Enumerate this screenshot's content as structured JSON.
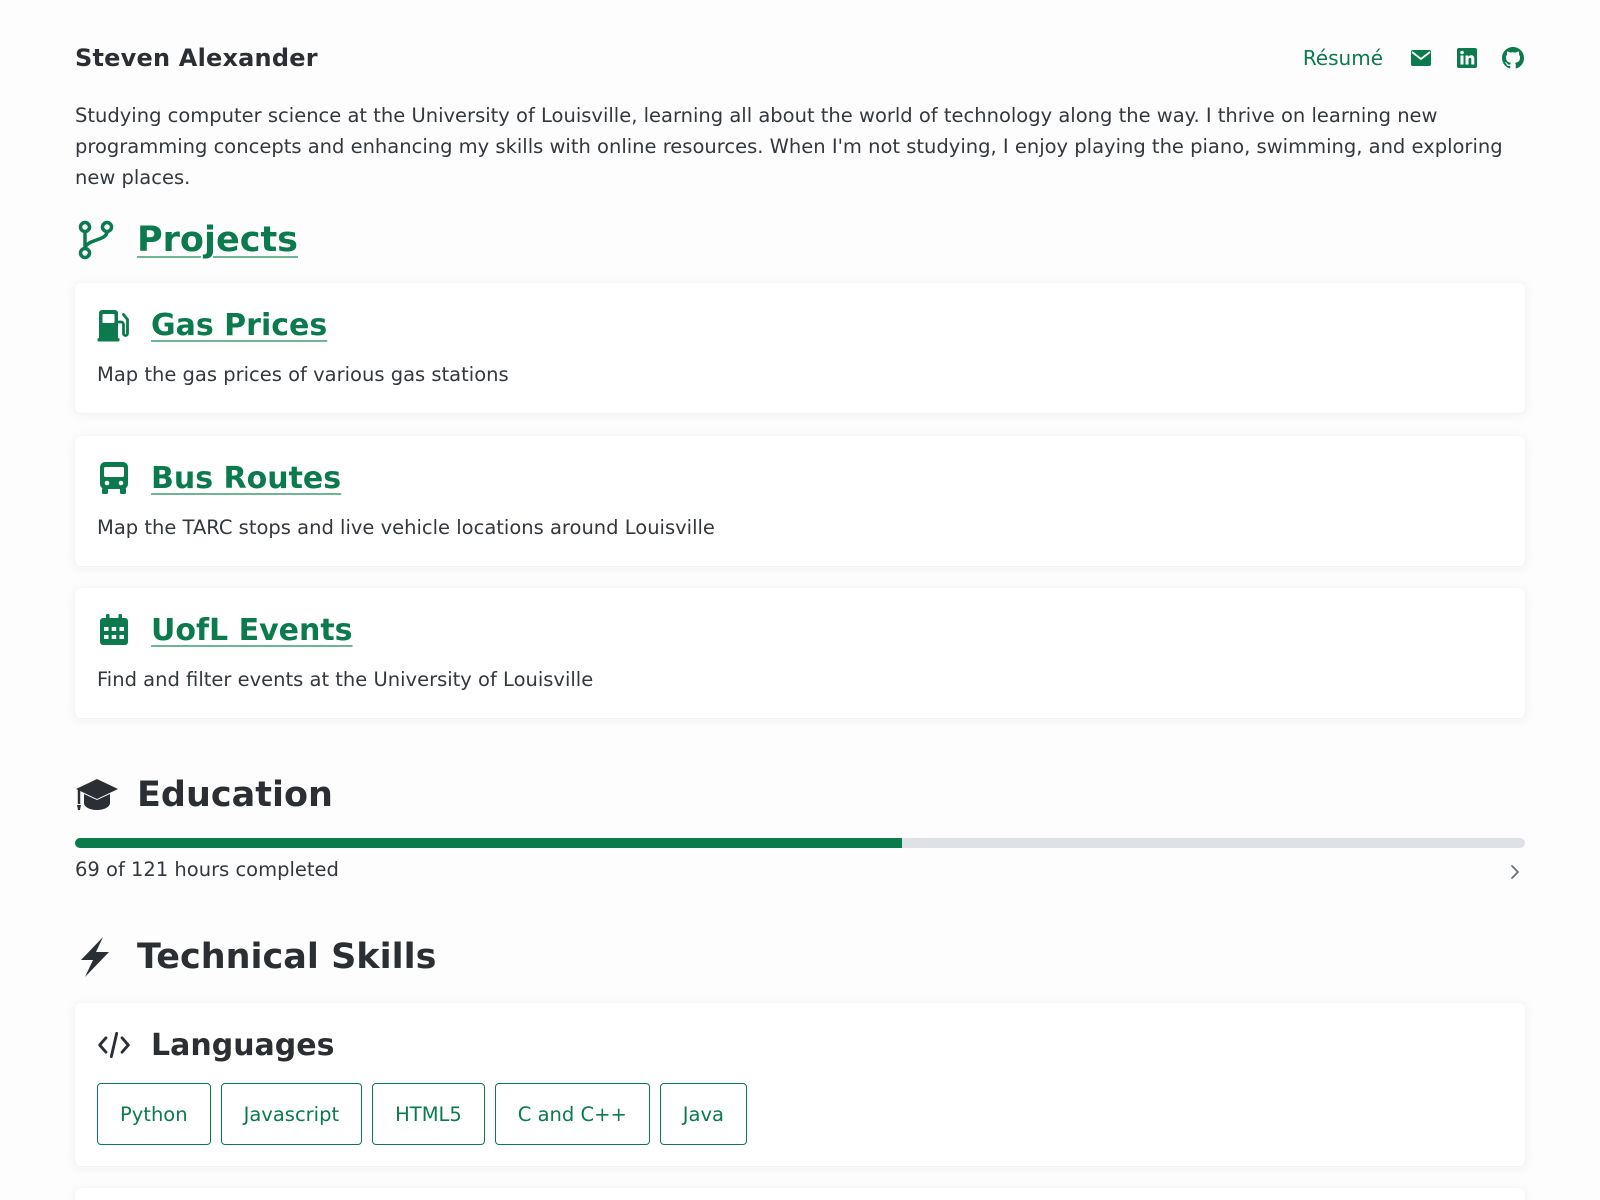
{
  "header": {
    "name": "Steven Alexander",
    "resume_label": "Résumé",
    "icons": [
      "envelope-icon",
      "linkedin-icon",
      "github-icon"
    ]
  },
  "bio": "Studying computer science at the University of Louisville, learning all about the world of technology along the way. I thrive on learning new programming concepts and enhancing my skills with online resources. When I'm not studying, I enjoy playing the piano, swimming, and exploring new places.",
  "projects": {
    "title": "Projects",
    "icon": "code-branch-icon",
    "items": [
      {
        "title": "Gas Prices",
        "description": "Map the gas prices of various gas stations",
        "icon": "gas-pump-icon"
      },
      {
        "title": "Bus Routes",
        "description": "Map the TARC stops and live vehicle locations around Louisville",
        "icon": "bus-icon"
      },
      {
        "title": "UofL Events",
        "description": "Find and filter events at the University of Louisville",
        "icon": "calendar-icon"
      }
    ]
  },
  "education": {
    "title": "Education",
    "icon": "graduation-cap-icon",
    "progress_fraction": 0.5702,
    "progress_text": "69 of 121 hours completed"
  },
  "skills": {
    "title": "Technical Skills",
    "icon": "bolt-icon",
    "languages": {
      "title": "Languages",
      "icon": "code-icon",
      "items": [
        "Python",
        "Javascript",
        "HTML5",
        "C and C++",
        "Java"
      ]
    }
  },
  "colors": {
    "accent": "#0b7a4d",
    "text": "#2b2f33",
    "track": "#dee2e6"
  }
}
